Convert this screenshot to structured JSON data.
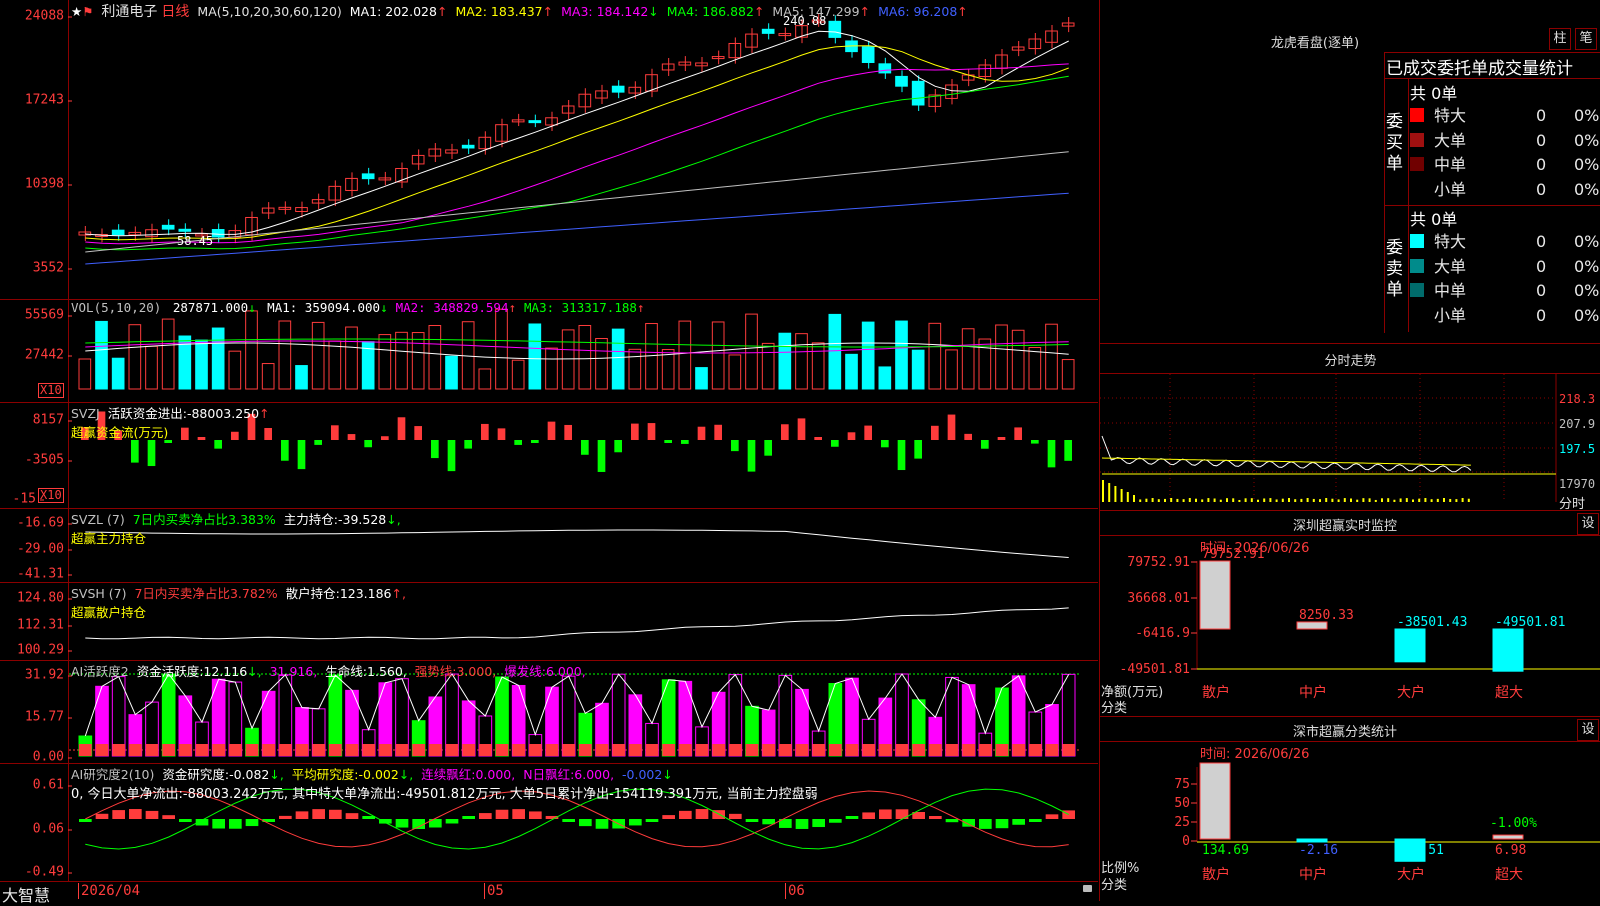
{
  "stock": {
    "name": "利通电子",
    "period": "日线",
    "ma_params": "MA(5,10,20,30,60,120)",
    "ma": [
      {
        "label": "MA1:",
        "value": "202.028",
        "arrow": "↑",
        "color": "#ffffff"
      },
      {
        "label": "MA2:",
        "value": "183.437",
        "arrow": "↑",
        "color": "#ffff00"
      },
      {
        "label": "MA3:",
        "value": "184.142",
        "arrow": "↓",
        "color": "#ff00ff"
      },
      {
        "label": "MA4:",
        "value": "186.882",
        "arrow": "↑",
        "color": "#00ff00"
      },
      {
        "label": "MA5:",
        "value": "147.299",
        "arrow": "↑",
        "color": "#c0c0c0"
      },
      {
        "label": "MA6:",
        "value": "96.208",
        "arrow": "↑",
        "color": "#4060ff"
      }
    ],
    "y_labels": [
      "24088",
      "17243",
      "10398",
      "3552"
    ],
    "high_label": "240.88",
    "low_label": "58.45",
    "colors": {
      "up": "#ff3c3c",
      "down": "#00ffff",
      "frame": "#8b0000",
      "axis_text": "#ff3c3c"
    }
  },
  "volume": {
    "legend_name": "VOL(5,10,20)",
    "value": "287871.000",
    "arrow": "↓",
    "ma": [
      {
        "label": "MA1:",
        "value": "359094.000",
        "arrow": "↓",
        "color": "#ffffff"
      },
      {
        "label": "MA2:",
        "value": "348829.594",
        "arrow": "↑",
        "color": "#ff00ff"
      },
      {
        "label": "MA3:",
        "value": "313317.188",
        "arrow": "↑",
        "color": "#00ff00"
      }
    ],
    "y_labels": [
      "55569",
      "27442"
    ],
    "unit": "X10"
  },
  "svzj": {
    "legend_name": "SVZJ",
    "line1_label": "活跃资金进出:",
    "line1_value": "-88003.250",
    "line1_arrow": "↑",
    "line2": "超赢资金流(万元)",
    "y_labels": [
      "8157",
      "-3505",
      "-15"
    ],
    "unit": "X10"
  },
  "svzl": {
    "legend_name": "SVZL (7)",
    "ratio_label": "7日内买卖净占比3.383%",
    "hold_label": "主力持仓:",
    "hold_value": "-39.528",
    "hold_arrow": "↓,",
    "line2": "超赢主力持仓",
    "y_labels": [
      "-16.69",
      "-29.00",
      "-41.31"
    ]
  },
  "svsh": {
    "legend_name": "SVSH (7)",
    "ratio_label": "7日内买卖净占比3.782%",
    "hold_label": "散户持仓:",
    "hold_value": "123.186",
    "hold_arrow": "↑,",
    "line2": "超赢散户持仓",
    "y_labels": [
      "124.80",
      "112.31",
      "100.29"
    ]
  },
  "ai_active": {
    "legend_name": "AI活跃度2",
    "l1_label": "资金活跃度:",
    "l1_value": "12.116",
    "l1_arrow": "↓,",
    "l2_value": "31.916,",
    "l3_label": "生命线:",
    "l3_value": "1.560,",
    "l4_label": "强势线:",
    "l4_value": "3.000,",
    "l5_label": "爆发线:",
    "l5_value": "6.000,",
    "y_labels": [
      "31.92",
      "15.77",
      "0.00"
    ]
  },
  "ai_research": {
    "legend_name": "AI研究度2(10)",
    "l1_label": "资金研究度:",
    "l1_value": "-0.082",
    "l1_arrow": "↓,",
    "l2_label": "平均研究度:",
    "l2_value": "-0.002",
    "l2_arrow": "↓,",
    "l3_label": "连续飘红:",
    "l3_value": "0.000,",
    "l4_label": "N日飘红:",
    "l4_value": "6.000,",
    "l5_value": "-0.002",
    "l5_arrow": "↓",
    "summary": "0, 今日大单净流出:-88003.242万元, 其中特大单净流出:-49501.812万元, 大单5日累计净出-154119.391万元, 当前主力控盘弱",
    "y_labels": [
      "0.61",
      "0.06",
      "-0.49"
    ]
  },
  "xaxis": {
    "labels": [
      "2026/04",
      "05",
      "06"
    ],
    "brand": "大智慧"
  },
  "dragon": {
    "title": "龙虎看盘(逐单)",
    "btn1": "柱",
    "btn2": "笔",
    "tabs": "已成交委托单成交量统计",
    "buy_side_label": "委买单",
    "sell_side_label": "委卖单",
    "buy_total": "共 0单",
    "sell_total": "共 0单",
    "buy_rows": [
      {
        "label": "特大",
        "count": "0",
        "pct": "0%",
        "color": "#ff0000"
      },
      {
        "label": "大单",
        "count": "0",
        "pct": "0%",
        "color": "#a01010"
      },
      {
        "label": "中单",
        "count": "0",
        "pct": "0%",
        "color": "#700000"
      },
      {
        "label": "小单",
        "count": "0",
        "pct": "0%",
        "color": "#000000"
      }
    ],
    "sell_rows": [
      {
        "label": "特大",
        "count": "0",
        "pct": "0%",
        "color": "#00ffff"
      },
      {
        "label": "大单",
        "count": "0",
        "pct": "0%",
        "color": "#008b8b"
      },
      {
        "label": "中单",
        "count": "0",
        "pct": "0%",
        "color": "#006b6b"
      },
      {
        "label": "小单",
        "count": "0",
        "pct": "0%",
        "color": "#000000"
      }
    ]
  },
  "intraday": {
    "title": "分时走势",
    "y_labels": [
      "218.3",
      "207.9",
      "197.5",
      "17970"
    ],
    "unit": "分时"
  },
  "monitor": {
    "title": "深圳超赢实时监控",
    "btn": "设",
    "time": "时间: 2026/06/26",
    "y_labels": [
      "79752.91",
      "36668.01",
      "-6416.9",
      "-49501.81"
    ],
    "axis_caption_1": "净额(万元)",
    "axis_caption_2": "分类",
    "bars": [
      {
        "cat": "散户",
        "value": 79752.91,
        "label": "79752.91",
        "label_color": "#ff3c3c"
      },
      {
        "cat": "中户",
        "value": 8250.33,
        "label": "8250.33",
        "label_color": "#ff3c3c"
      },
      {
        "cat": "大户",
        "value": -38501.43,
        "label": "-38501.43",
        "label_color": "#00ffff"
      },
      {
        "cat": "超大",
        "value": -49501.81,
        "label": "-49501.81",
        "label_color": "#00ffff"
      }
    ]
  },
  "classify": {
    "title": "深市超赢分类统计",
    "btn": "设",
    "time": "时间: 2026/06/26",
    "y_labels": [
      "75",
      "50",
      "25",
      "0"
    ],
    "axis_caption_1": "比例%",
    "axis_caption_2": "分类",
    "bars": [
      {
        "cat": "散户",
        "value": 134.69,
        "label": "134.69",
        "label_color": "#00ff00"
      },
      {
        "cat": "中户",
        "value": -2.16,
        "label": "-2.16",
        "label_color": "#4060ff"
      },
      {
        "cat": "大户",
        "value": -39.51,
        "label": "-39.51",
        "label_color": "#00ffff"
      },
      {
        "cat": "超大",
        "value": 6.98,
        "label": "6.98",
        "label_color": "#ff3c3c",
        "extra": "-1.00%"
      }
    ]
  }
}
